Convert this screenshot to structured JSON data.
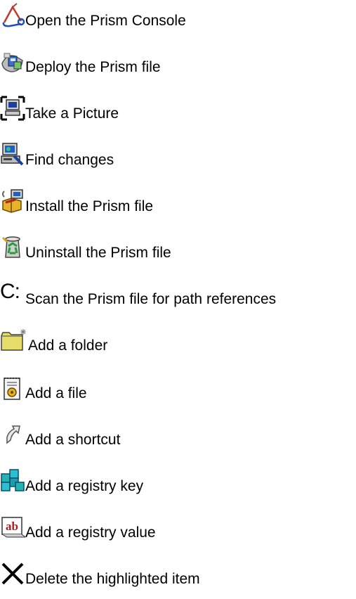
{
  "items": [
    {
      "icon": "console-icon",
      "label": "Open the Prism Console"
    },
    {
      "icon": "deploy-icon",
      "label": "Deploy the Prism file"
    },
    {
      "icon": "camera-monitor-icon",
      "label": "Take a Picture"
    },
    {
      "icon": "find-changes-icon",
      "label": "Find changes"
    },
    {
      "icon": "install-package-icon",
      "label": "Install the Prism file"
    },
    {
      "icon": "uninstall-recycle-icon",
      "label": "Uninstall the Prism file"
    },
    {
      "icon": "drive-c-icon",
      "glyph": "C:",
      "label": "Scan the Prism file for path references"
    },
    {
      "icon": "new-folder-icon",
      "label": "Add a folder"
    },
    {
      "icon": "file-gear-icon",
      "label": "Add a file"
    },
    {
      "icon": "shortcut-arrow-icon",
      "label": "Add a shortcut"
    },
    {
      "icon": "registry-key-icon",
      "label": "Add a registry key"
    },
    {
      "icon": "registry-value-icon",
      "glyph": "ab",
      "label": "Add a registry value"
    },
    {
      "icon": "delete-x-icon",
      "label": "Delete the highlighted item"
    }
  ]
}
